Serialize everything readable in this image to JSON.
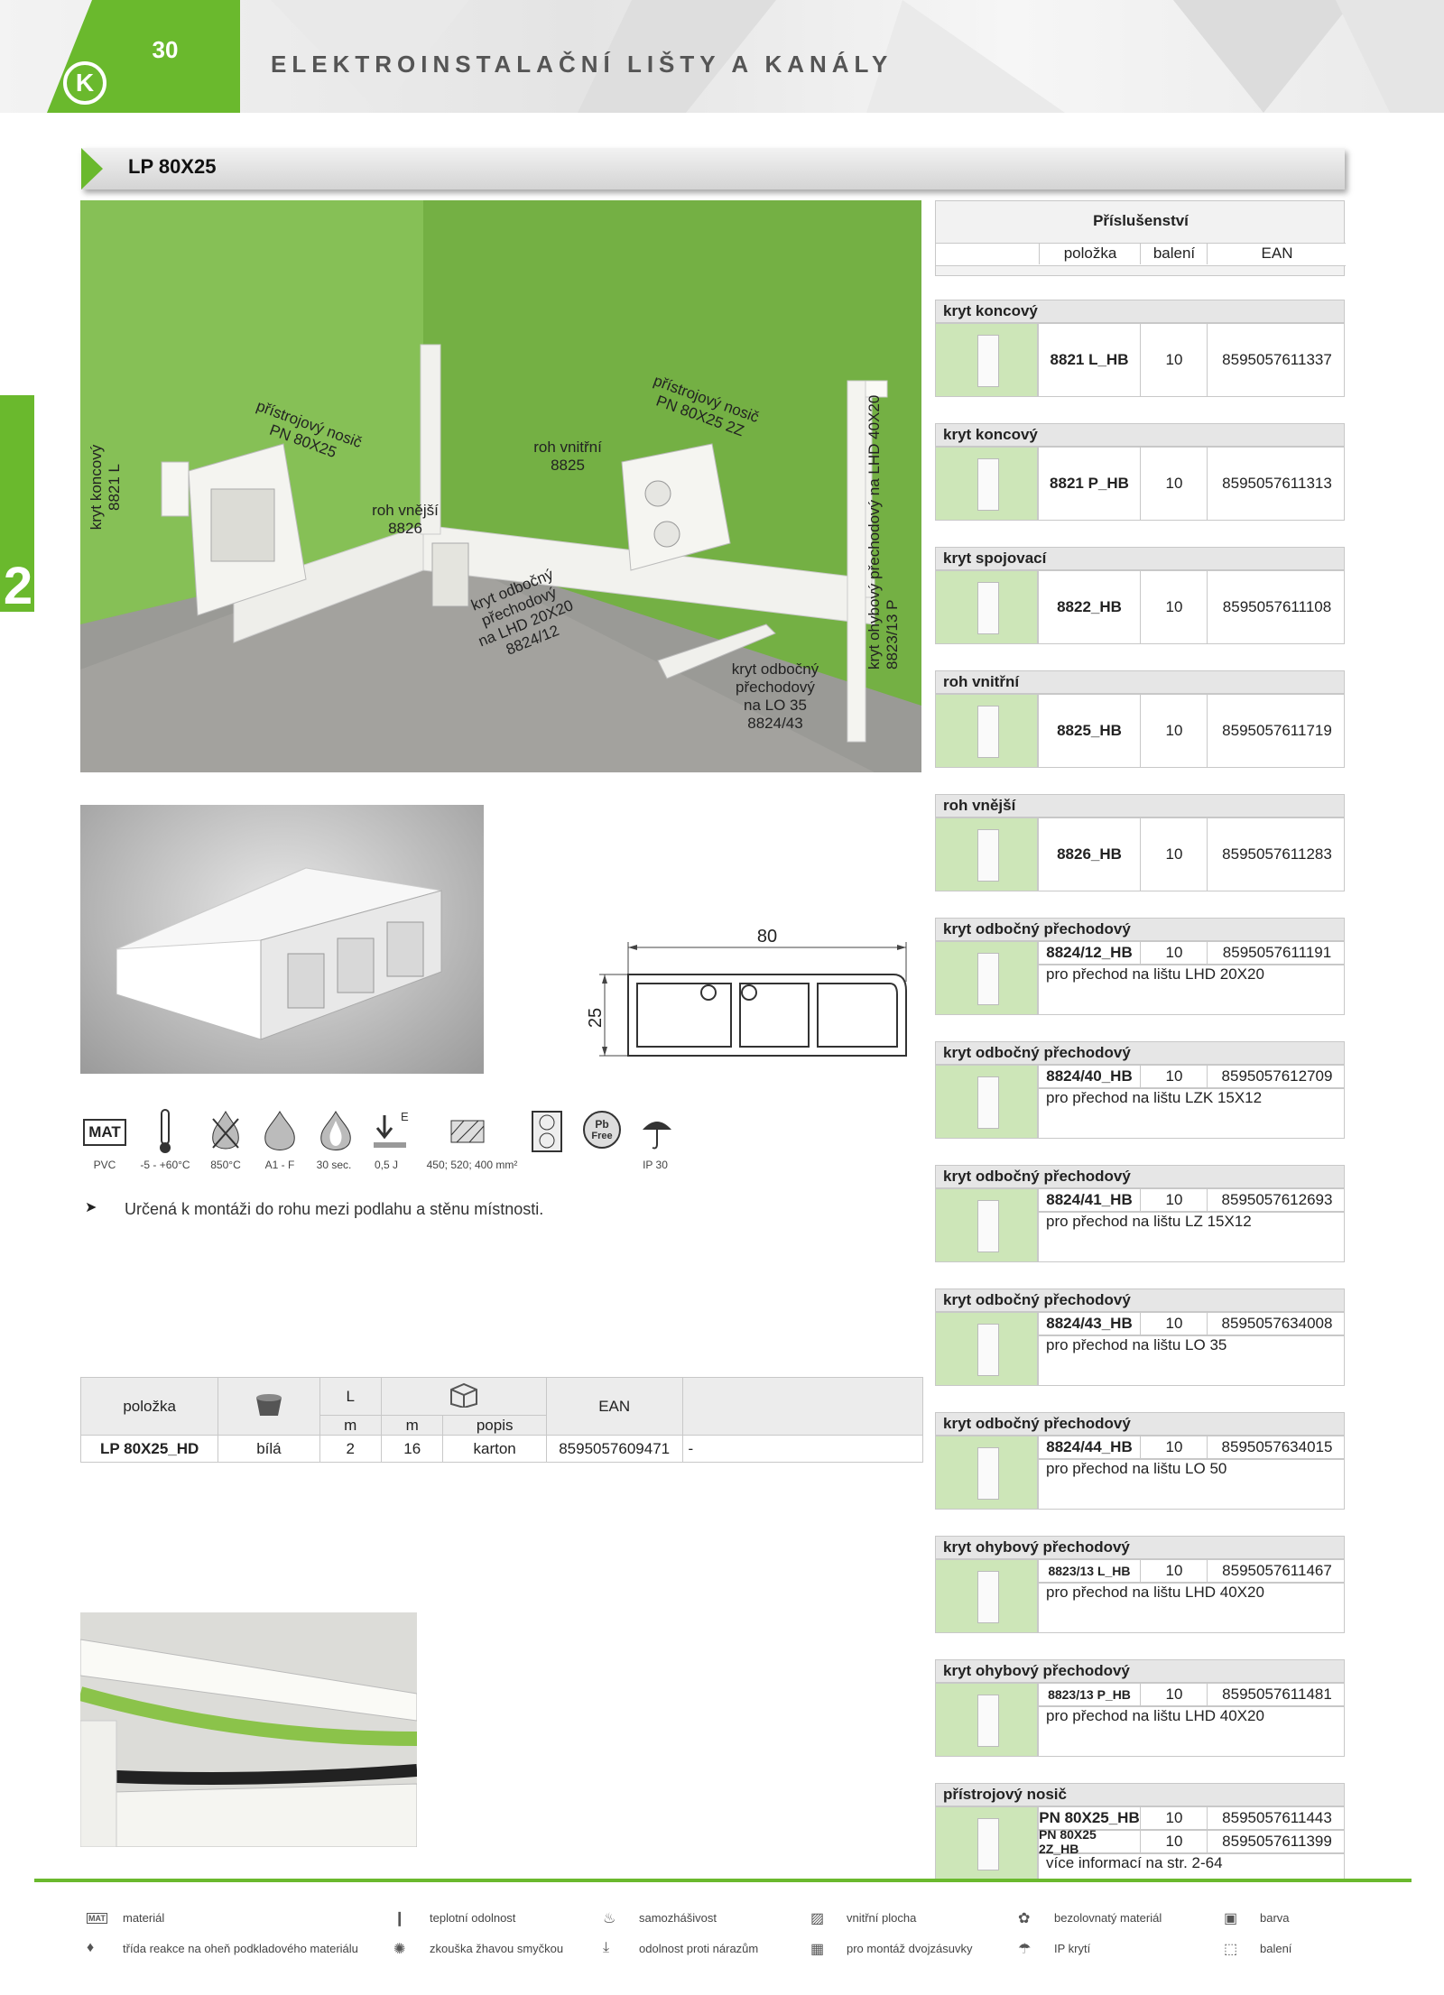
{
  "header": {
    "page_number": "30",
    "title": "ELEKTROINSTALAČNÍ LIŠTY A KANÁLY",
    "logo": "K"
  },
  "side_marker": "2",
  "product_title": "LP 80X25",
  "photo_labels": {
    "end_cap_left": [
      "kryt koncový",
      "8821 L"
    ],
    "device_carrier": [
      "přístrojový nosič",
      "PN 80X25"
    ],
    "outer_corner": [
      "roh vnější",
      "8826"
    ],
    "inner_corner": [
      "roh vnitřní",
      "8825"
    ],
    "device_carrier_2z": [
      "přístrojový nosič",
      "PN 80X25 2Z"
    ],
    "branch_lhd": [
      "kryt odbočný",
      "přechodový",
      "na LHD 20X20",
      "8824/12"
    ],
    "branch_lo": [
      "kryt odbočný",
      "přechodový",
      "na LO 35",
      "8824/43"
    ],
    "bend_cover": [
      "kryt ohybový přechodový na LHD 40X20",
      "8823/13 P"
    ]
  },
  "drawing": {
    "width": "80",
    "height": "25"
  },
  "icons": [
    {
      "name": "material-icon",
      "caption": "PVC"
    },
    {
      "name": "temperature-icon",
      "caption": "-5 - +60°C"
    },
    {
      "name": "glow-wire-icon",
      "caption": "850°C"
    },
    {
      "name": "flame-class-icon",
      "caption": "A1 - F"
    },
    {
      "name": "self-extinguish-icon",
      "caption": "30 sec."
    },
    {
      "name": "impact-icon",
      "caption": "0,5 J"
    },
    {
      "name": "inner-area-icon",
      "caption": "450; 520; 400 mm²"
    },
    {
      "name": "double-socket-icon",
      "caption": ""
    },
    {
      "name": "pb-free-icon",
      "caption": ""
    },
    {
      "name": "ip-icon",
      "caption": "IP 30"
    }
  ],
  "icon_texts": {
    "mat": "MAT",
    "impact_letter": "E",
    "pb": "Pb",
    "free": "Free"
  },
  "note": "Určená k montáži do rohu mezi podlahu a stěnu místnosti.",
  "product_table": {
    "headers": {
      "item": "položka",
      "length": "L",
      "ean": "EAN"
    },
    "subheaders": [
      "m",
      "m",
      "popis"
    ],
    "rows": [
      {
        "item": "LP 80X25_HD",
        "color": "bílá",
        "length": "2",
        "qty": "16",
        "package": "karton",
        "ean": "8595057609471",
        "extra": "-"
      }
    ]
  },
  "accessories": {
    "title": "Příslušenství",
    "columns": [
      "položka",
      "balení",
      "EAN"
    ],
    "groups": [
      {
        "name": "kryt koncový",
        "rows": [
          {
            "code": "8821 L_HB",
            "pack": "10",
            "ean": "8595057611337"
          }
        ],
        "desc": ""
      },
      {
        "name": "kryt koncový",
        "rows": [
          {
            "code": "8821 P_HB",
            "pack": "10",
            "ean": "8595057611313"
          }
        ],
        "desc": ""
      },
      {
        "name": "kryt spojovací",
        "rows": [
          {
            "code": "8822_HB",
            "pack": "10",
            "ean": "8595057611108"
          }
        ],
        "desc": ""
      },
      {
        "name": "roh vnitřní",
        "rows": [
          {
            "code": "8825_HB",
            "pack": "10",
            "ean": "8595057611719"
          }
        ],
        "desc": ""
      },
      {
        "name": "roh vnější",
        "rows": [
          {
            "code": "8826_HB",
            "pack": "10",
            "ean": "8595057611283"
          }
        ],
        "desc": ""
      },
      {
        "name": "kryt odbočný přechodový",
        "rows": [
          {
            "code": "8824/12_HB",
            "pack": "10",
            "ean": "8595057611191"
          }
        ],
        "desc": "pro přechod na lištu LHD 20X20"
      },
      {
        "name": "kryt odbočný přechodový",
        "rows": [
          {
            "code": "8824/40_HB",
            "pack": "10",
            "ean": "8595057612709"
          }
        ],
        "desc": "pro přechod na lištu LZK 15X12"
      },
      {
        "name": "kryt odbočný přechodový",
        "rows": [
          {
            "code": "8824/41_HB",
            "pack": "10",
            "ean": "8595057612693"
          }
        ],
        "desc": "pro přechod na lištu LZ 15X12"
      },
      {
        "name": "kryt odbočný přechodový",
        "rows": [
          {
            "code": "8824/43_HB",
            "pack": "10",
            "ean": "8595057634008"
          }
        ],
        "desc": "pro přechod na lištu LO 35"
      },
      {
        "name": "kryt odbočný přechodový",
        "rows": [
          {
            "code": "8824/44_HB",
            "pack": "10",
            "ean": "8595057634015"
          }
        ],
        "desc": "pro přechod na lištu LO 50"
      },
      {
        "name": "kryt ohybový přechodový",
        "rows": [
          {
            "code": "8823/13 L_HB",
            "pack": "10",
            "ean": "8595057611467"
          }
        ],
        "desc": "pro přechod na lištu LHD 40X20"
      },
      {
        "name": "kryt ohybový přechodový",
        "rows": [
          {
            "code": "8823/13 P_HB",
            "pack": "10",
            "ean": "8595057611481"
          }
        ],
        "desc": "pro přechod na lištu LHD 40X20"
      },
      {
        "name": "přístrojový nosič",
        "rows": [
          {
            "code": "PN 80X25_HB",
            "pack": "10",
            "ean": "8595057611443"
          },
          {
            "code": "PN 80X25 2Z_HB",
            "pack": "10",
            "ean": "8595057611399"
          }
        ],
        "desc": "více informací na str. 2-64"
      }
    ]
  },
  "legend": [
    {
      "icon": "MAT",
      "label": "materiál"
    },
    {
      "icon": "❙",
      "label": "teplotní odolnost"
    },
    {
      "icon": "♨",
      "label": "samozhášivost"
    },
    {
      "icon": "▨",
      "label": "vnitřní plocha"
    },
    {
      "icon": "✿",
      "label": "bezolovnatý materiál"
    },
    {
      "icon": "▣",
      "label": "barva"
    },
    {
      "icon": "♦",
      "label": "třída reakce na oheň podkladového materiálu"
    },
    {
      "icon": "✺",
      "label": "zkouška žhavou smyčkou"
    },
    {
      "icon": "⤓",
      "label": "odolnost proti nárazům"
    },
    {
      "icon": "▦",
      "label": "pro montáž dvojzásuvky"
    },
    {
      "icon": "☂",
      "label": "IP krytí"
    },
    {
      "icon": "⬚",
      "label": "balení"
    }
  ]
}
